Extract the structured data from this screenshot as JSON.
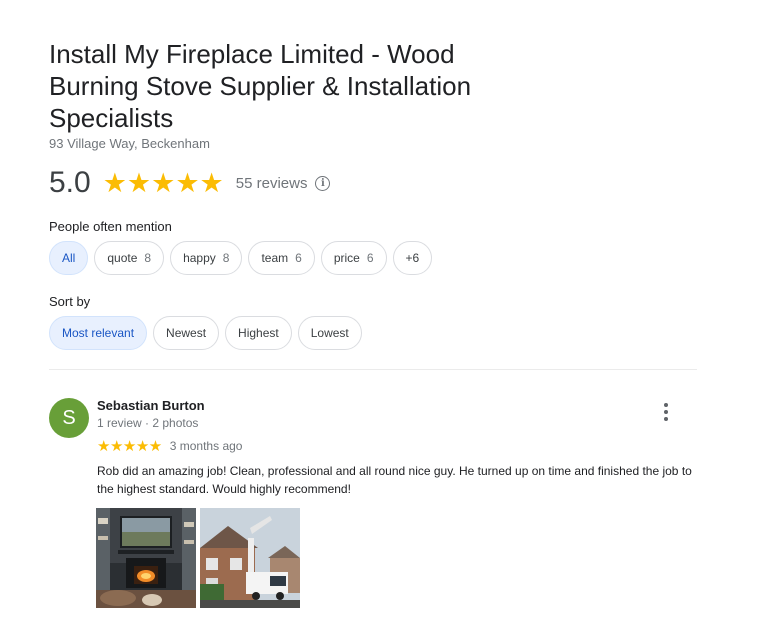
{
  "business": {
    "name": "Install My Fireplace Limited - Wood Burning Stove Supplier & Installation Specialists",
    "address": "93 Village Way, Beckenham",
    "rating": "5.0",
    "stars": "★★★★★",
    "review_count": "55 reviews",
    "info_icon": "i"
  },
  "mentions": {
    "label": "People often mention",
    "chips": [
      {
        "label": "All",
        "count": ""
      },
      {
        "label": "quote",
        "count": "8"
      },
      {
        "label": "happy",
        "count": "8"
      },
      {
        "label": "team",
        "count": "6"
      },
      {
        "label": "price",
        "count": "6"
      },
      {
        "label": "+6",
        "count": ""
      }
    ]
  },
  "sort": {
    "label": "Sort by",
    "options": [
      "Most relevant",
      "Newest",
      "Highest",
      "Lowest"
    ]
  },
  "review": {
    "avatar_letter": "S",
    "avatar_color": "#689f38",
    "name": "Sebastian Burton",
    "meta": "1 review · 2 photos",
    "stars": "★★★★★",
    "date": "3 months ago",
    "text": "Rob did an amazing job! Clean, professional and all round nice guy. He turned up on time and finished the job to the highest standard. Would highly recommend!"
  },
  "colors": {
    "star": "#fbbc04",
    "active_chip_bg": "#e8f0fe",
    "active_chip_text": "#1a56c4"
  }
}
